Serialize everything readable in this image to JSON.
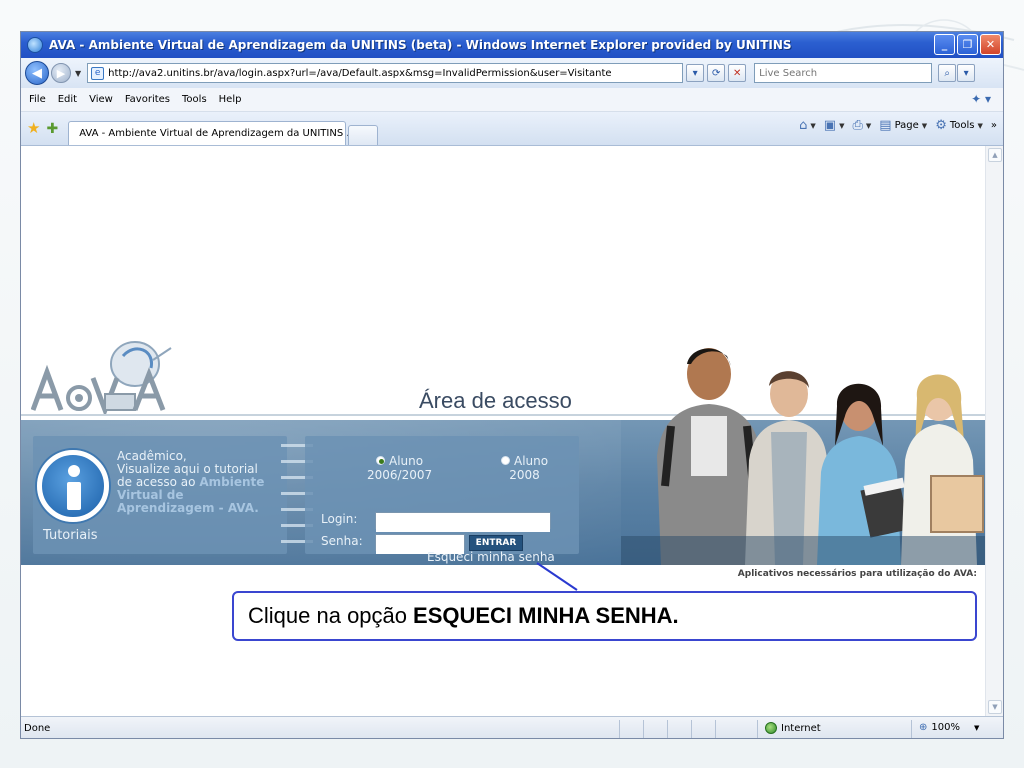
{
  "window": {
    "title": "AVA - Ambiente Virtual de Aprendizagem da UNITINS (beta) - Windows Internet Explorer provided by UNITINS",
    "minimize": "_",
    "maximize": "❐",
    "close": "✕"
  },
  "address": {
    "url": "http://ava2.unitins.br/ava/login.aspx?url=/ava/Default.aspx&msg=InvalidPermission&user=Visitante",
    "search_placeholder": "Live Search"
  },
  "menu": {
    "items": [
      "File",
      "Edit",
      "View",
      "Favorites",
      "Tools",
      "Help"
    ]
  },
  "tabs": {
    "active_label": "AVA - Ambiente Virtual de Aprendizagem da UNITINS ..."
  },
  "commands": {
    "page": "Page",
    "tools": "Tools"
  },
  "page": {
    "area_title": "Área de acesso",
    "tutorial": {
      "line1": "Acadêmico,",
      "line2": "Visualize aqui o tutorial",
      "line3": "de acesso ao ",
      "highlight": "Ambiente Virtual de Aprendizagem - AVA.",
      "label": "Tutoriais"
    },
    "login": {
      "radio1_a": "Aluno",
      "radio1_b": "2006/2007",
      "radio2_a": "Aluno",
      "radio2_b": "2008",
      "login_label": "Login:",
      "senha_label": "Senha:",
      "login_value": "",
      "senha_value": "",
      "button": "ENTRAR",
      "forgot": "Esqueci minha senha"
    },
    "apps_note": "Aplicativos necessários para utilização do AVA:"
  },
  "callout": {
    "prefix": "Clique na opção",
    "bold": "ESQUECI MINHA SENHA."
  },
  "status": {
    "text": "Done",
    "zone": "Internet",
    "zoom": "100%"
  },
  "colors": {
    "banner": "#5b82a5",
    "callout_border": "#3a46d0",
    "title_bar": "#2b5fd0"
  }
}
